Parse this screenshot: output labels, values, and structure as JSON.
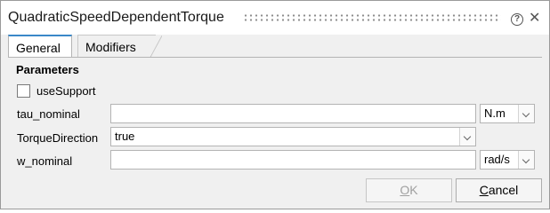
{
  "window": {
    "title": "QuadraticSpeedDependentTorque",
    "help_glyph": "?",
    "close_glyph": "✕"
  },
  "tabs": [
    {
      "label": "General",
      "active": true
    },
    {
      "label": "Modifiers",
      "active": false
    }
  ],
  "parameters": {
    "section_title": "Parameters",
    "use_support": {
      "label": "useSupport",
      "checked": false
    },
    "rows": [
      {
        "label": "tau_nominal",
        "value": "",
        "unit": "N.m"
      },
      {
        "label": "TorqueDirection",
        "value": "true"
      },
      {
        "label": "w_nominal",
        "value": "",
        "unit": "rad/s"
      }
    ]
  },
  "buttons": {
    "ok": {
      "label": "OK",
      "mnemonic": "O",
      "rest": "K",
      "enabled": false
    },
    "cancel": {
      "label": "Cancel",
      "mnemonic": "C",
      "rest": "ancel",
      "enabled": true
    }
  },
  "colors": {
    "tab_accent": "#3a88c8",
    "disabled_text": "#a0a0a0"
  },
  "icons": [
    "help-icon",
    "close-icon",
    "chevron-down-icon",
    "drag-grip-icon"
  ]
}
